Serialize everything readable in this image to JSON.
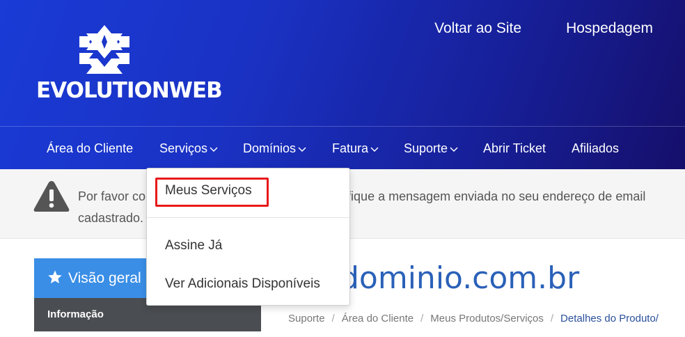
{
  "brand": {
    "name": "EVOLUTIONWEB"
  },
  "top_links": [
    "Voltar ao Site",
    "Hospedagem"
  ],
  "nav": {
    "items": [
      {
        "label": "Área do Cliente",
        "has_dropdown": false
      },
      {
        "label": "Serviços",
        "has_dropdown": true
      },
      {
        "label": "Domínios",
        "has_dropdown": true
      },
      {
        "label": "Fatura",
        "has_dropdown": true
      },
      {
        "label": "Suporte",
        "has_dropdown": true
      },
      {
        "label": "Abrir Ticket",
        "has_dropdown": false
      },
      {
        "label": "Afiliados",
        "has_dropdown": false
      }
    ]
  },
  "dropdown": {
    "items": [
      "Meus Serviços",
      "Assine Já",
      "Ver Adicionais Disponíveis"
    ],
    "highlighted_index": 0
  },
  "alert": {
    "text_left": "Por favor co",
    "text_right": "ifique a mensagem enviada no seu endereço de email",
    "text_line2": "cadastrado."
  },
  "sidebar": {
    "title": "Visão geral",
    "item": "Informação"
  },
  "page": {
    "title": "dominio.com.br"
  },
  "breadcrumb": [
    "Suporte",
    "Área do Cliente",
    "Meus Produtos/Serviços",
    "Detalhes do Produto/"
  ],
  "colors": {
    "header_start": "#1a3bd6",
    "header_end": "#150f6b",
    "panel_head": "#3a8ee6",
    "panel_body": "#4a4d51",
    "title": "#2a61b8",
    "highlight": "#e8191b"
  },
  "icons": {
    "alert": "warning-triangle-icon",
    "sidebar": "star-icon",
    "dropdown_caret": "chevron-down-icon"
  }
}
